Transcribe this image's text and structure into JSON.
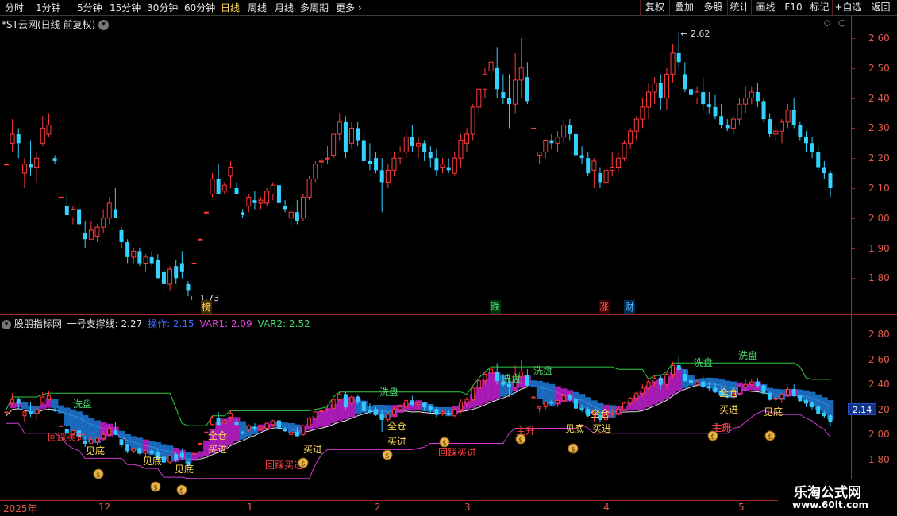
{
  "toolbar": {
    "periods": [
      "分时",
      "1分钟",
      "5分钟",
      "15分钟",
      "30分钟",
      "60分钟",
      "日线",
      "周线",
      "月线",
      "多周期",
      "更多"
    ],
    "active_period": "日线",
    "buttons": [
      "复权",
      "叠加",
      "多股",
      "统计",
      "画线",
      "F10",
      "标记",
      "+自选",
      "返回"
    ]
  },
  "chart_header": {
    "title": "*ST云网(日线 前复权)",
    "high_label": "2.62",
    "low_label": "1.73"
  },
  "price_axis": [
    "2.60",
    "2.50",
    "2.40",
    "2.30",
    "2.20",
    "2.10",
    "2.00",
    "1.90",
    "1.80"
  ],
  "event_markers": [
    {
      "text": "榜",
      "color": "#ffd75a"
    },
    {
      "text": "跌",
      "color": "#4ad76a"
    },
    {
      "text": "涨",
      "color": "#ff5a5a"
    },
    {
      "text": "财",
      "color": "#5ab4ff"
    }
  ],
  "indicator": {
    "name": "股朋指标网",
    "line1_label": "一号支撑线: 2.27",
    "line2_label": "操作: 2.15",
    "line3_label": "VAR1: 2.09",
    "line4_label": "VAR2: 2.52",
    "axis": [
      "2.80",
      "2.60",
      "2.40",
      "2.20",
      "2.00",
      "1.80"
    ],
    "current_value": "2.14",
    "signals": [
      {
        "text": "洗盘",
        "color": "#4ad76a"
      },
      {
        "text": "回踩买进",
        "color": "#ff4040"
      },
      {
        "text": "见底",
        "color": "#ffd75a"
      },
      {
        "text": "见底",
        "color": "#ffd75a"
      },
      {
        "text": "见底",
        "color": "#ffd75a"
      },
      {
        "text": "全仓",
        "color": "#ffd75a"
      },
      {
        "text": "买进",
        "color": "#ffd75a"
      },
      {
        "text": "回踩买进",
        "color": "#ff4040"
      },
      {
        "text": "买进",
        "color": "#ffd75a"
      },
      {
        "text": "洗盘",
        "color": "#4ad76a"
      },
      {
        "text": "买进",
        "color": "#ffd75a"
      },
      {
        "text": "全仓",
        "color": "#ffd75a"
      },
      {
        "text": "主升",
        "color": "#ff4040"
      },
      {
        "text": "回踩买进",
        "color": "#ff4040"
      },
      {
        "text": "洗盘",
        "color": "#4ad76a"
      },
      {
        "text": "洗盘",
        "color": "#4ad76a"
      },
      {
        "text": "主升",
        "color": "#ff4040"
      },
      {
        "text": "见底",
        "color": "#ffd75a"
      },
      {
        "text": "全仓",
        "color": "#ffd75a"
      },
      {
        "text": "买进",
        "color": "#ffd75a"
      },
      {
        "text": "洗盘",
        "color": "#4ad76a"
      },
      {
        "text": "洗盘",
        "color": "#4ad76a"
      },
      {
        "text": "主升",
        "color": "#ff4040"
      },
      {
        "text": "全仓",
        "color": "#ffd75a"
      },
      {
        "text": "买进",
        "color": "#ffd75a"
      },
      {
        "text": "见底",
        "color": "#ffd75a"
      }
    ]
  },
  "x_axis": [
    "2025年",
    "12",
    "1",
    "2",
    "3",
    "4",
    "5"
  ],
  "watermark": {
    "line1": "乐淘公式网",
    "line2": "www.60lt.com"
  },
  "colors": {
    "up": "#ff3b3b",
    "down": "#33d2ff",
    "axis": "#e05a4a",
    "grid": "#a32a2a"
  },
  "chart_data": {
    "type": "candlestick",
    "ylim": [
      1.73,
      2.62
    ],
    "candles": [
      [
        2.18,
        2.18,
        2.18,
        2.18
      ],
      [
        2.25,
        2.33,
        2.22,
        2.28
      ],
      [
        2.28,
        2.3,
        2.2,
        2.25
      ],
      [
        2.15,
        2.2,
        2.1,
        2.18
      ],
      [
        2.18,
        2.26,
        2.14,
        2.17
      ],
      [
        2.17,
        2.22,
        2.12,
        2.2
      ],
      [
        2.25,
        2.34,
        2.24,
        2.3
      ],
      [
        2.28,
        2.35,
        2.27,
        2.31
      ],
      [
        2.2,
        2.21,
        2.18,
        2.19
      ],
      [
        2.07,
        2.07,
        2.07,
        2.07
      ],
      [
        2.04,
        2.08,
        2.01,
        2.01
      ],
      [
        2.0,
        2.04,
        1.98,
        2.03
      ],
      [
        2.03,
        2.05,
        1.96,
        1.98
      ],
      [
        1.95,
        1.99,
        1.9,
        1.93
      ],
      [
        1.93,
        1.99,
        1.93,
        1.96
      ],
      [
        1.94,
        1.98,
        1.92,
        1.97
      ],
      [
        1.97,
        2.03,
        1.95,
        2.0
      ],
      [
        2.0,
        2.07,
        1.98,
        2.05
      ],
      [
        2.03,
        2.1,
        2.01,
        2.0
      ],
      [
        1.96,
        1.97,
        1.9,
        1.92
      ],
      [
        1.92,
        1.93,
        1.85,
        1.87
      ],
      [
        1.87,
        1.9,
        1.85,
        1.89
      ],
      [
        1.89,
        1.9,
        1.84,
        1.85
      ],
      [
        1.85,
        1.88,
        1.82,
        1.87
      ],
      [
        1.87,
        1.89,
        1.84,
        1.85
      ],
      [
        1.86,
        1.88,
        1.83,
        1.8
      ],
      [
        1.82,
        1.85,
        1.75,
        1.78
      ],
      [
        1.78,
        1.84,
        1.76,
        1.83
      ],
      [
        1.84,
        1.86,
        1.78,
        1.8
      ],
      [
        1.85,
        1.89,
        1.8,
        1.82
      ],
      [
        1.78,
        1.79,
        1.74,
        1.76
      ],
      [
        1.85,
        1.85,
        1.85,
        1.85
      ],
      [
        1.93,
        1.93,
        1.93,
        1.93
      ],
      [
        2.02,
        2.02,
        2.02,
        2.02
      ],
      [
        2.08,
        2.15,
        2.07,
        2.13
      ],
      [
        2.13,
        2.18,
        2.09,
        2.08
      ],
      [
        2.09,
        2.12,
        2.08,
        2.11
      ],
      [
        2.14,
        2.19,
        2.1,
        2.17
      ],
      [
        2.1,
        2.12,
        2.08,
        2.08
      ],
      [
        2.02,
        2.03,
        2.0,
        2.01
      ],
      [
        2.04,
        2.08,
        2.02,
        2.07
      ],
      [
        2.06,
        2.09,
        2.03,
        2.05
      ],
      [
        2.05,
        2.07,
        2.03,
        2.06
      ],
      [
        2.05,
        2.1,
        2.04,
        2.09
      ],
      [
        2.08,
        2.12,
        2.06,
        2.11
      ],
      [
        2.11,
        2.13,
        2.04,
        2.05
      ],
      [
        2.04,
        2.06,
        2.02,
        2.03
      ],
      [
        2.0,
        2.04,
        1.97,
        2.02
      ],
      [
        2.02,
        2.06,
        1.98,
        1.99
      ],
      [
        2.0,
        2.08,
        1.99,
        2.07
      ],
      [
        2.07,
        2.14,
        2.06,
        2.13
      ],
      [
        2.13,
        2.19,
        2.12,
        2.18
      ],
      [
        2.19,
        2.2,
        2.17,
        2.19
      ],
      [
        2.2,
        2.24,
        2.18,
        2.2
      ],
      [
        2.21,
        2.28,
        2.2,
        2.28
      ],
      [
        2.28,
        2.35,
        2.26,
        2.32
      ],
      [
        2.32,
        2.34,
        2.2,
        2.22
      ],
      [
        2.25,
        2.32,
        2.23,
        2.3
      ],
      [
        2.3,
        2.32,
        2.24,
        2.26
      ],
      [
        2.26,
        2.28,
        2.18,
        2.19
      ],
      [
        2.19,
        2.25,
        2.16,
        2.18
      ],
      [
        2.2,
        2.22,
        2.15,
        2.16
      ],
      [
        2.16,
        2.2,
        2.02,
        2.12
      ],
      [
        2.12,
        2.18,
        2.1,
        2.16
      ],
      [
        2.16,
        2.22,
        2.14,
        2.2
      ],
      [
        2.2,
        2.24,
        2.18,
        2.22
      ],
      [
        2.22,
        2.29,
        2.2,
        2.27
      ],
      [
        2.27,
        2.31,
        2.22,
        2.24
      ],
      [
        2.24,
        2.27,
        2.2,
        2.25
      ],
      [
        2.25,
        2.26,
        2.19,
        2.22
      ],
      [
        2.22,
        2.24,
        2.17,
        2.2
      ],
      [
        2.2,
        2.23,
        2.14,
        2.16
      ],
      [
        2.17,
        2.2,
        2.15,
        2.18
      ],
      [
        2.17,
        2.2,
        2.15,
        2.16
      ],
      [
        2.15,
        2.22,
        2.14,
        2.2
      ],
      [
        2.2,
        2.28,
        2.17,
        2.26
      ],
      [
        2.25,
        2.3,
        2.22,
        2.28
      ],
      [
        2.28,
        2.38,
        2.26,
        2.37
      ],
      [
        2.37,
        2.44,
        2.34,
        2.43
      ],
      [
        2.43,
        2.5,
        2.4,
        2.48
      ],
      [
        2.49,
        2.56,
        2.45,
        2.52
      ],
      [
        2.5,
        2.57,
        2.4,
        2.43
      ],
      [
        2.42,
        2.48,
        2.38,
        2.4
      ],
      [
        2.4,
        2.48,
        2.3,
        2.38
      ],
      [
        2.38,
        2.55,
        2.35,
        2.46
      ],
      [
        2.46,
        2.6,
        2.4,
        2.5
      ],
      [
        2.47,
        2.52,
        2.38,
        2.39
      ],
      [
        2.3,
        2.3,
        2.3,
        2.3
      ],
      [
        2.21,
        2.22,
        2.18,
        2.22
      ],
      [
        2.22,
        2.25,
        2.2,
        2.26
      ],
      [
        2.26,
        2.28,
        2.23,
        2.25
      ],
      [
        2.25,
        2.29,
        2.22,
        2.27
      ],
      [
        2.27,
        2.33,
        2.25,
        2.31
      ],
      [
        2.31,
        2.33,
        2.26,
        2.28
      ],
      [
        2.28,
        2.29,
        2.2,
        2.21
      ],
      [
        2.21,
        2.24,
        2.18,
        2.2
      ],
      [
        2.2,
        2.22,
        2.14,
        2.15
      ],
      [
        2.16,
        2.2,
        2.1,
        2.19
      ],
      [
        2.15,
        2.17,
        2.1,
        2.12
      ],
      [
        2.12,
        2.18,
        2.1,
        2.16
      ],
      [
        2.16,
        2.22,
        2.14,
        2.17
      ],
      [
        2.17,
        2.22,
        2.15,
        2.2
      ],
      [
        2.2,
        2.26,
        2.19,
        2.25
      ],
      [
        2.25,
        2.3,
        2.23,
        2.29
      ],
      [
        2.29,
        2.34,
        2.26,
        2.33
      ],
      [
        2.33,
        2.4,
        2.3,
        2.37
      ],
      [
        2.37,
        2.45,
        2.33,
        2.42
      ],
      [
        2.42,
        2.47,
        2.38,
        2.45
      ],
      [
        2.45,
        2.48,
        2.36,
        2.4
      ],
      [
        2.4,
        2.5,
        2.36,
        2.48
      ],
      [
        2.48,
        2.58,
        2.45,
        2.55
      ],
      [
        2.55,
        2.62,
        2.5,
        2.52
      ],
      [
        2.48,
        2.52,
        2.42,
        2.43
      ],
      [
        2.43,
        2.45,
        2.4,
        2.41
      ],
      [
        2.4,
        2.44,
        2.38,
        2.42
      ],
      [
        2.42,
        2.47,
        2.36,
        2.38
      ],
      [
        2.38,
        2.42,
        2.35,
        2.37
      ],
      [
        2.37,
        2.41,
        2.33,
        2.34
      ],
      [
        2.34,
        2.38,
        2.3,
        2.31
      ],
      [
        2.31,
        2.33,
        2.29,
        2.3
      ],
      [
        2.3,
        2.34,
        2.28,
        2.33
      ],
      [
        2.33,
        2.4,
        2.31,
        2.38
      ],
      [
        2.38,
        2.44,
        2.35,
        2.4
      ],
      [
        2.4,
        2.44,
        2.38,
        2.42
      ],
      [
        2.42,
        2.45,
        2.37,
        2.39
      ],
      [
        2.39,
        2.4,
        2.32,
        2.33
      ],
      [
        2.33,
        2.35,
        2.27,
        2.28
      ],
      [
        2.28,
        2.31,
        2.26,
        2.29
      ],
      [
        2.29,
        2.33,
        2.25,
        2.32
      ],
      [
        2.32,
        2.38,
        2.3,
        2.36
      ],
      [
        2.36,
        2.4,
        2.3,
        2.31
      ],
      [
        2.31,
        2.32,
        2.26,
        2.27
      ],
      [
        2.27,
        2.29,
        2.22,
        2.25
      ],
      [
        2.25,
        2.27,
        2.2,
        2.22
      ],
      [
        2.22,
        2.24,
        2.16,
        2.17
      ],
      [
        2.17,
        2.19,
        2.13,
        2.15
      ],
      [
        2.15,
        2.16,
        2.07,
        2.1
      ]
    ]
  }
}
